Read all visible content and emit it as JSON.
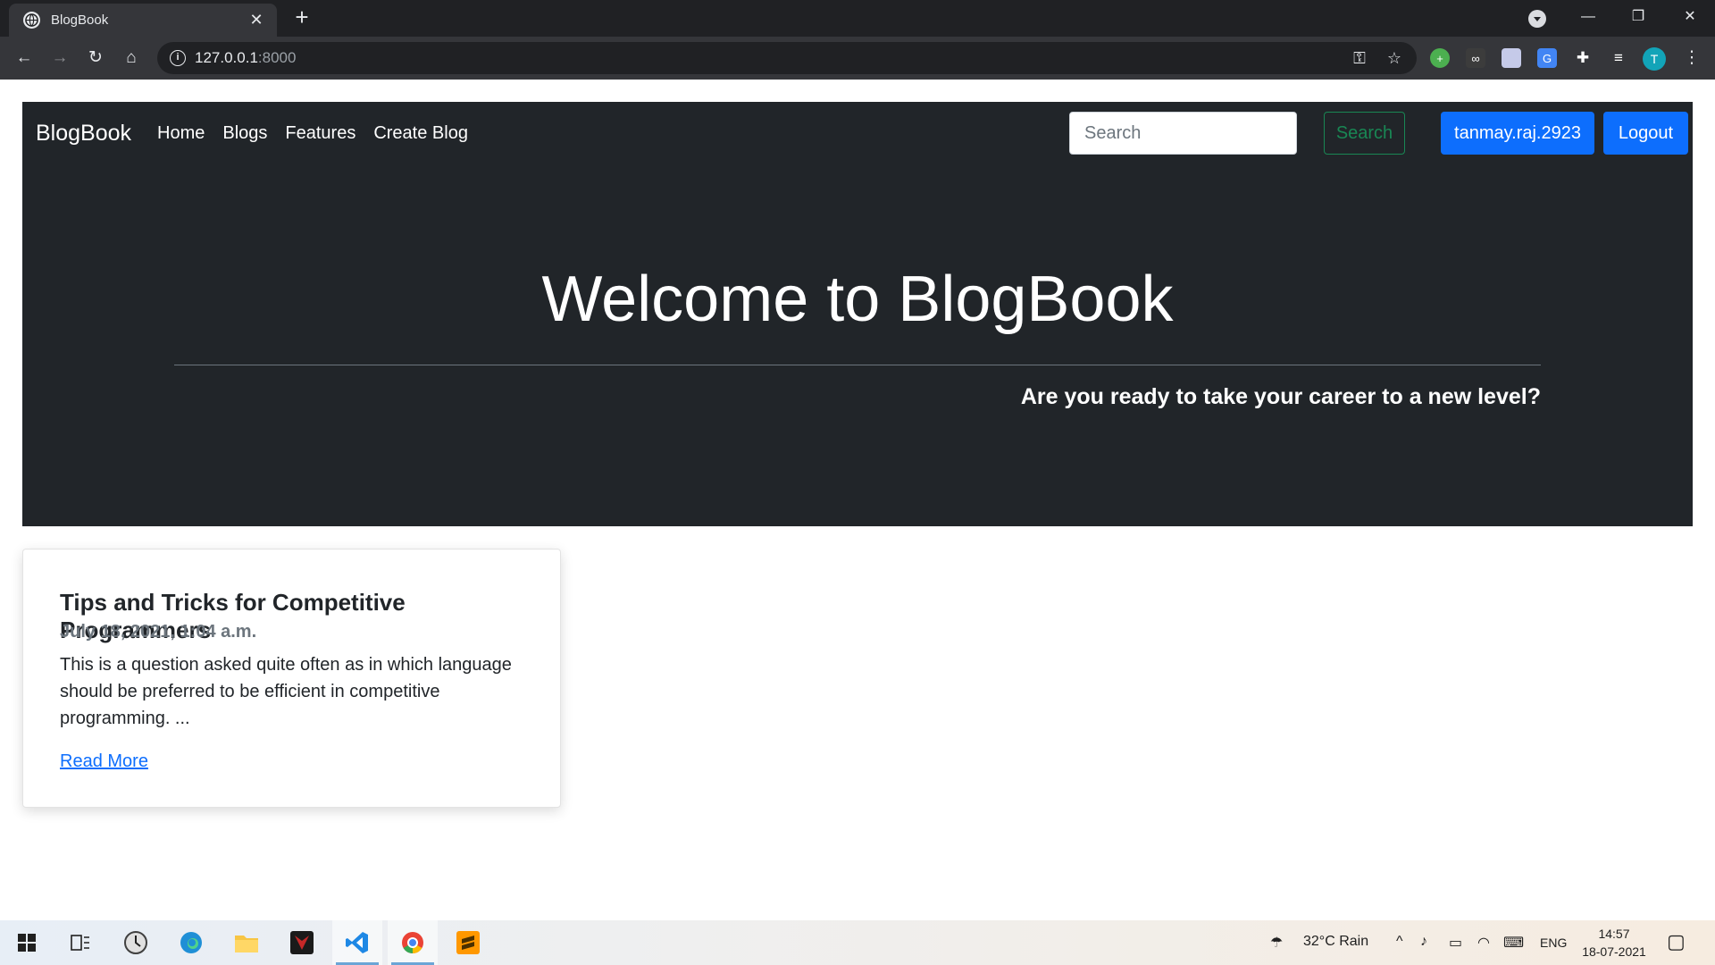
{
  "browser": {
    "tab_title": "BlogBook",
    "tab_close": "✕",
    "new_tab": "+",
    "window_controls": {
      "minimize": "—",
      "maximize": "❐",
      "close": "✕"
    },
    "address": {
      "host": "127.0.0.1",
      "port": ":8000"
    },
    "nav": {
      "back": "←",
      "forward": "→",
      "reload": "↻",
      "home": "⌂"
    },
    "omnibox_icons": {
      "info": "i",
      "key": "⚿",
      "star": "☆"
    },
    "profile_initial": "T",
    "menu": "⋮"
  },
  "navbar": {
    "brand": "BlogBook",
    "links": [
      "Home",
      "Blogs",
      "Features",
      "Create Blog"
    ],
    "search_placeholder": "Search",
    "search_button": "Search",
    "user_button": "tanmay.raj.2923",
    "logout_button": "Logout"
  },
  "hero": {
    "title": "Welcome to BlogBook",
    "lead": "Are you ready to take your career to a new level?"
  },
  "posts": [
    {
      "title": "Tips and Tricks for Competitive Programmers",
      "date": "July 18, 2021, 1:04 a.m.",
      "excerpt": "This is a question asked quite often as in which language should be preferred to be efficient in competitive programming. ...",
      "link": "Read More"
    }
  ],
  "taskbar": {
    "weather": "32°C  Rain",
    "language": "ENG",
    "time": "14:57",
    "date": "18-07-2021",
    "tray_arrow": "^"
  },
  "colors": {
    "primary": "#0d6efd",
    "success": "#198754",
    "dark": "#212529"
  }
}
